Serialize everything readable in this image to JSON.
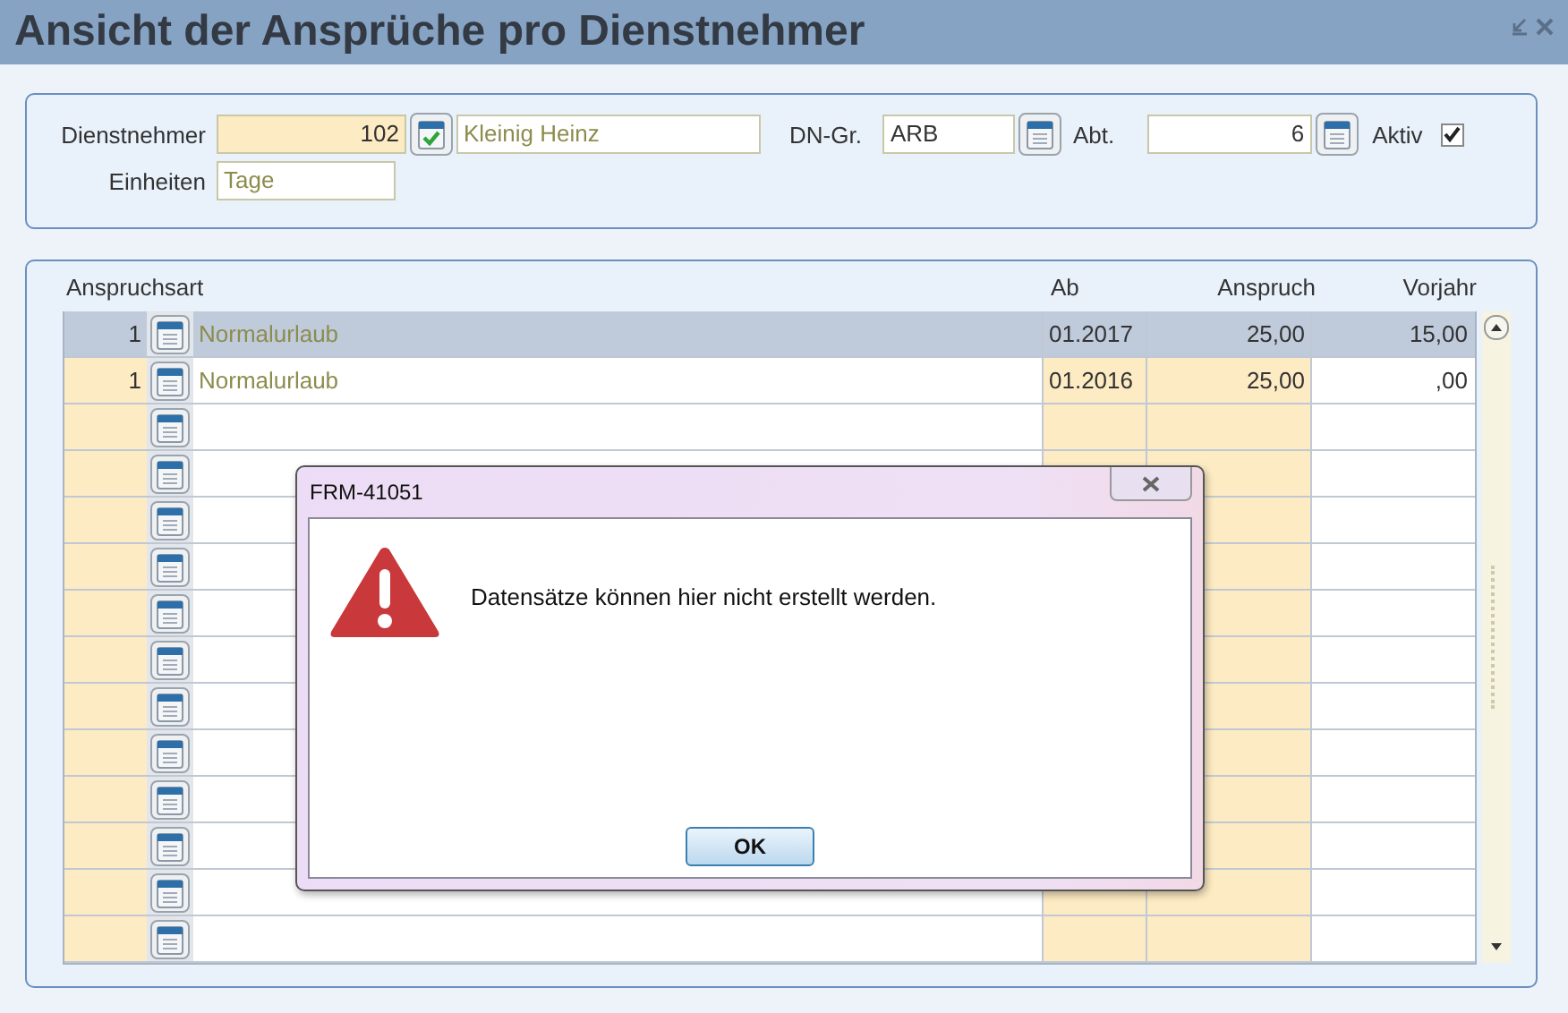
{
  "window": {
    "title": "Ansicht der Ansprüche pro Dienstnehmer"
  },
  "header": {
    "dienstnehmer_label": "Dienstnehmer",
    "dienstnehmer_nr": "102",
    "dienstnehmer_name": "Kleinig Heinz",
    "dn_gr_label": "DN-Gr.",
    "dn_gr": "ARB",
    "abt_label": "Abt.",
    "abt": "6",
    "aktiv_label": "Aktiv",
    "aktiv_checked": true,
    "einheiten_label": "Einheiten",
    "einheiten": "Tage"
  },
  "table": {
    "columns": [
      "Anspruchsart",
      "Ab",
      "Anspruch",
      "Vorjahr"
    ],
    "rows": [
      {
        "nr": "1",
        "art": "Normalurlaub",
        "ab": "01.2017",
        "anspruch": "25,00",
        "vorjahr": "15,00",
        "selected": true
      },
      {
        "nr": "1",
        "art": "Normalurlaub",
        "ab": "01.2016",
        "anspruch": "25,00",
        "vorjahr": ",00",
        "selected": false
      },
      {
        "selected": false
      },
      {
        "selected": false
      },
      {
        "selected": false
      },
      {
        "selected": false
      },
      {
        "selected": false
      },
      {
        "selected": false
      },
      {
        "selected": false
      },
      {
        "selected": false
      },
      {
        "selected": false
      },
      {
        "selected": false
      },
      {
        "selected": false
      },
      {
        "selected": false
      }
    ]
  },
  "dialog": {
    "title": "FRM-41051",
    "message": "Datensätze können hier nicht erstellt werden.",
    "button": "OK"
  }
}
